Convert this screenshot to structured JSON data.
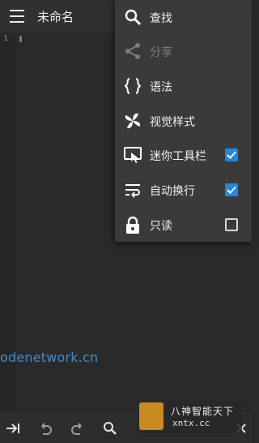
{
  "toolbar": {
    "title": "未命名"
  },
  "editor": {
    "line_number": "1"
  },
  "watermark_text": "odenetwork.cn",
  "menu": {
    "items": [
      {
        "label": "查找",
        "icon": "search-icon"
      },
      {
        "label": "分享",
        "icon": "share-icon",
        "disabled": true
      },
      {
        "label": "语法",
        "icon": "braces-icon"
      },
      {
        "label": "视觉样式",
        "icon": "pinwheel-icon"
      },
      {
        "label": "迷你工具栏",
        "icon": "mini-toolbar-icon",
        "checked": true
      },
      {
        "label": "自动换行",
        "icon": "wrap-icon",
        "checked": true
      },
      {
        "label": "只读",
        "icon": "lock-icon",
        "checked": false
      }
    ]
  },
  "bottom_bar": {
    "icons": [
      "tab-icon",
      "undo-icon",
      "redo-icon",
      "search-icon",
      "close-icon"
    ]
  },
  "site_watermark": {
    "line1": "八神智能天下",
    "line2": "xntx.cc"
  },
  "colors": {
    "accent": "#1e88e5",
    "background": "#2b2a2a",
    "menu": "#3a3a3a"
  }
}
